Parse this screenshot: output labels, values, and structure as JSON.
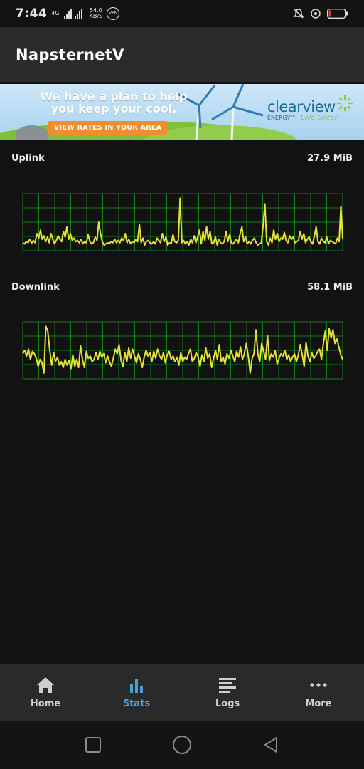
{
  "status_bar": {
    "time": "7:44",
    "network_type": "4G",
    "speed_value": "54.0",
    "speed_unit": "KB/S",
    "vpn_label": "VPN",
    "icons": [
      "signal-icon",
      "vpn-icon",
      "bell-off-icon",
      "alarm-icon",
      "battery-icon"
    ]
  },
  "app_bar": {
    "title": "NapsternetV"
  },
  "ad": {
    "headline_line1": "We have a plan to help",
    "headline_line2": "you keep your cool.",
    "cta": "VIEW RATES IN YOUR AREA",
    "brand": "clearview",
    "brand_sub": "ENERGY™",
    "brand_tagline": "Live Green"
  },
  "stats": [
    {
      "label": "Uplink",
      "value": "27.9 MiB"
    },
    {
      "label": "Downlink",
      "value": "58.1 MiB"
    }
  ],
  "chart_data": [
    {
      "type": "line",
      "ylim": [
        0,
        1
      ],
      "grid": true,
      "series": [
        {
          "values": [
            0.14,
            0.12,
            0.16,
            0.14,
            0.2,
            0.13,
            0.18,
            0.14,
            0.3,
            0.22,
            0.36,
            0.2,
            0.26,
            0.16,
            0.24,
            0.14,
            0.3,
            0.2,
            0.12,
            0.18,
            0.26,
            0.2,
            0.16,
            0.34,
            0.24,
            0.42,
            0.2,
            0.3,
            0.18,
            0.22,
            0.16,
            0.18,
            0.14,
            0.2,
            0.12,
            0.16,
            0.14,
            0.28,
            0.16,
            0.12,
            0.14,
            0.24,
            0.18,
            0.5,
            0.3,
            0.16,
            0.1,
            0.12,
            0.14,
            0.12,
            0.16,
            0.14,
            0.2,
            0.14,
            0.18,
            0.14,
            0.22,
            0.18,
            0.3,
            0.14,
            0.2,
            0.12,
            0.16,
            0.14,
            0.2,
            0.16,
            0.46,
            0.14,
            0.22,
            0.1,
            0.16,
            0.18,
            0.14,
            0.12,
            0.16,
            0.12,
            0.22,
            0.18,
            0.14,
            0.3,
            0.16,
            0.24,
            0.1,
            0.14,
            0.12,
            0.28,
            0.16,
            0.14,
            0.18,
            0.92,
            0.14,
            0.18,
            0.12,
            0.16,
            0.1,
            0.2,
            0.14,
            0.26,
            0.14,
            0.24,
            0.36,
            0.12,
            0.34,
            0.18,
            0.42,
            0.2,
            0.34,
            0.12,
            0.14,
            0.24,
            0.1,
            0.2,
            0.14,
            0.12,
            0.16,
            0.34,
            0.16,
            0.28,
            0.14,
            0.12,
            0.16,
            0.2,
            0.14,
            0.3,
            0.42,
            0.16,
            0.24,
            0.12,
            0.16,
            0.12,
            0.18,
            0.22,
            0.14,
            0.1,
            0.12,
            0.14,
            0.44,
            0.82,
            0.16,
            0.1,
            0.22,
            0.14,
            0.36,
            0.2,
            0.3,
            0.16,
            0.22,
            0.2,
            0.32,
            0.18,
            0.14,
            0.26,
            0.2,
            0.24,
            0.14,
            0.16,
            0.18,
            0.34,
            0.2,
            0.3,
            0.14,
            0.2,
            0.24,
            0.16,
            0.12,
            0.26,
            0.42,
            0.16,
            0.12,
            0.22,
            0.16,
            0.14,
            0.24,
            0.12,
            0.18,
            0.16,
            0.14,
            0.12,
            0.22,
            0.16,
            0.78,
            0.2
          ]
        }
      ]
    },
    {
      "type": "line",
      "ylim": [
        0,
        1
      ],
      "grid": true,
      "series": [
        {
          "values": [
            0.44,
            0.5,
            0.4,
            0.52,
            0.34,
            0.48,
            0.44,
            0.36,
            0.22,
            0.34,
            0.28,
            0.1,
            0.92,
            0.84,
            0.5,
            0.24,
            0.46,
            0.3,
            0.38,
            0.24,
            0.3,
            0.2,
            0.34,
            0.24,
            0.32,
            0.18,
            0.42,
            0.22,
            0.34,
            0.2,
            0.58,
            0.34,
            0.2,
            0.48,
            0.36,
            0.4,
            0.3,
            0.34,
            0.46,
            0.34,
            0.48,
            0.38,
            0.44,
            0.28,
            0.4,
            0.3,
            0.22,
            0.36,
            0.52,
            0.44,
            0.6,
            0.32,
            0.22,
            0.46,
            0.3,
            0.54,
            0.36,
            0.52,
            0.4,
            0.28,
            0.44,
            0.34,
            0.2,
            0.38,
            0.5,
            0.4,
            0.46,
            0.3,
            0.48,
            0.36,
            0.52,
            0.4,
            0.34,
            0.46,
            0.28,
            0.42,
            0.48,
            0.34,
            0.4,
            0.3,
            0.38,
            0.24,
            0.46,
            0.3,
            0.38,
            0.34,
            0.44,
            0.52,
            0.3,
            0.36,
            0.46,
            0.38,
            0.22,
            0.42,
            0.3,
            0.54,
            0.36,
            0.44,
            0.2,
            0.36,
            0.5,
            0.34,
            0.6,
            0.3,
            0.38,
            0.26,
            0.44,
            0.36,
            0.5,
            0.4,
            0.3,
            0.48,
            0.38,
            0.56,
            0.34,
            0.44,
            0.62,
            0.4,
            0.1,
            0.36,
            0.44,
            0.86,
            0.44,
            0.3,
            0.62,
            0.48,
            0.34,
            0.76,
            0.32,
            0.44,
            0.38,
            0.5,
            0.26,
            0.36,
            0.44,
            0.4,
            0.5,
            0.34,
            0.42,
            0.3,
            0.38,
            0.44,
            0.3,
            0.42,
            0.6,
            0.42,
            0.22,
            0.64,
            0.4,
            0.3,
            0.46,
            0.36,
            0.4,
            0.48,
            0.52,
            0.34,
            0.62,
            0.84,
            0.5,
            0.88,
            0.72,
            0.86,
            0.62,
            0.7,
            0.56,
            0.42,
            0.34
          ]
        }
      ]
    }
  ],
  "bottom_nav": [
    {
      "label": "Home",
      "icon": "home-icon",
      "active": false
    },
    {
      "label": "Stats",
      "icon": "stats-icon",
      "active": true
    },
    {
      "label": "Logs",
      "icon": "logs-icon",
      "active": false
    },
    {
      "label": "More",
      "icon": "more-icon",
      "active": false
    }
  ],
  "system_nav": [
    "recents-icon",
    "home-circle-icon",
    "back-icon"
  ],
  "colors": {
    "background": "#121212",
    "app_bar": "#2b2b2b",
    "chart_line": "#e3e33a",
    "chart_grid": "#1f9d1f",
    "active_tab": "#4a9fd8"
  }
}
